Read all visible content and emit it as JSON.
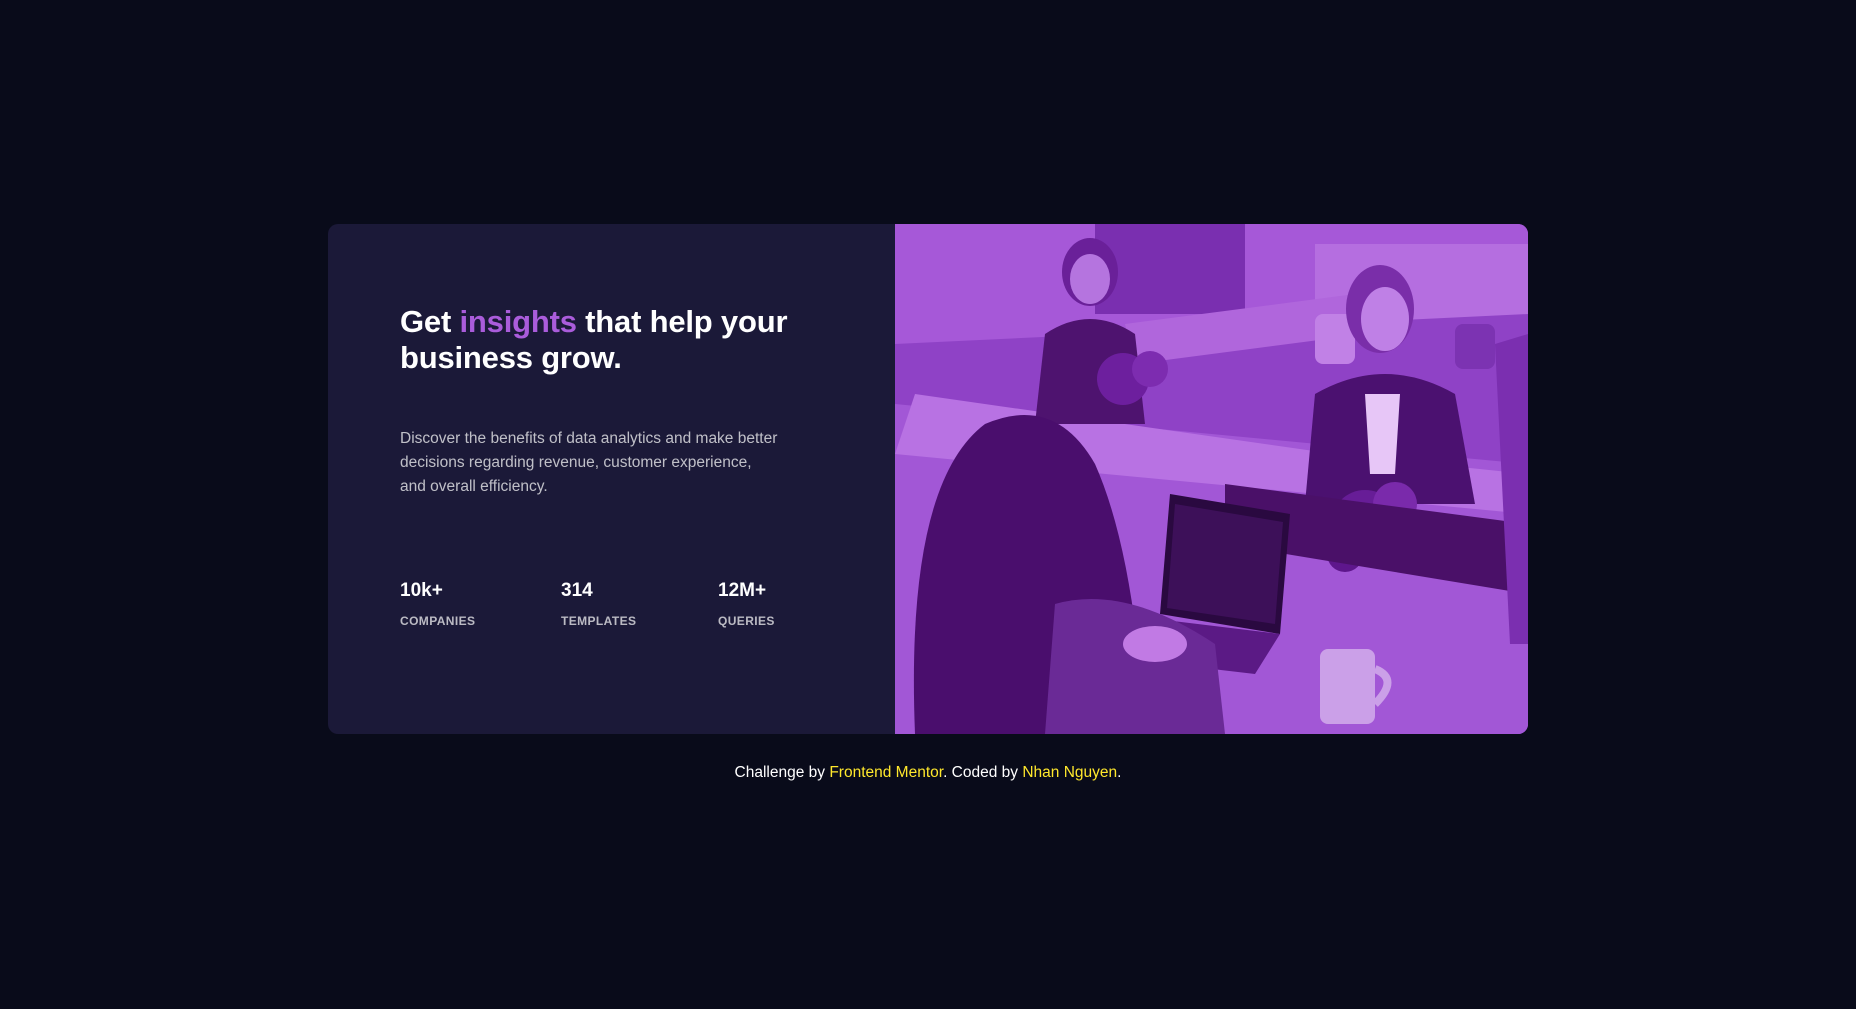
{
  "card": {
    "headline": {
      "prefix": "Get ",
      "accent": "insights",
      "suffix": " that help your business grow."
    },
    "description": "Discover the benefits of data analytics and make better decisions regarding revenue, customer experience, and overall efficiency.",
    "stats": [
      {
        "value": "10k+",
        "label": "COMPANIES"
      },
      {
        "value": "314",
        "label": "TEMPLATES"
      },
      {
        "value": "12M+",
        "label": "QUERIES"
      }
    ],
    "image": {
      "alt": "people working in an office"
    }
  },
  "attribution": {
    "challenge_prefix": "Challenge by",
    "challenge_link": "Frontend Mentor",
    "coded_prefix": ". Coded by",
    "coded_link": "Nhan Nguyen",
    "end": "."
  },
  "colors": {
    "background": "#090b1a",
    "card": "#1b1938",
    "accent": "#aa5cdb",
    "image_overlay": "#8a3fc4",
    "link": "#ffe82c"
  }
}
